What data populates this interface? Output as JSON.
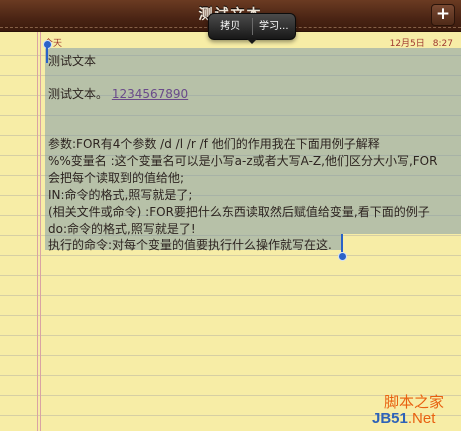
{
  "header": {
    "title": "测试文本",
    "add_label": "+"
  },
  "edit_menu": {
    "copy_label": "拷贝",
    "learn_label": "学习..."
  },
  "note": {
    "date_left": "今天",
    "date_right": "12月5日",
    "time_right": "8:27",
    "lines": [
      "测试文本",
      "测试文本。",
      "参数:FOR有4个参数 /d   /l   /r   /f   他们的作用我在下面用例子解释",
      "%%变量名 :这个变量名可以是小写a-z或者大写A-Z,他们区分大小写,FOR",
      "会把每个读取到的值给他;",
      "IN:命令的格式,照写就是了;",
      "(相关文件或命令) :FOR要把什么东西读取然后赋值给变量,看下面的例子",
      "do:命令的格式,照写就是了!",
      "执行的命令:对每个变量的值要执行什么操作就写在这."
    ],
    "link": "1234567890"
  },
  "watermark": {
    "cn": "脚本之家",
    "en_main": "JB51",
    "en_suffix": ".Net"
  },
  "colors": {
    "accent": "#2a62c8",
    "date": "#a03a30",
    "paper": "#f7eda6"
  }
}
